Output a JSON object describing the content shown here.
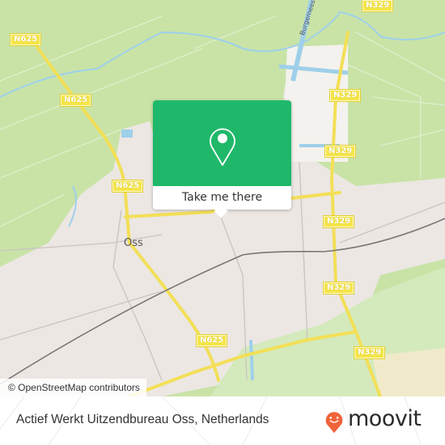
{
  "map": {
    "city_label": "Oss",
    "street_label": "Burgemeest",
    "road_labels": [
      {
        "id": "n625-a",
        "text": "N625"
      },
      {
        "id": "n625-b",
        "text": "N625"
      },
      {
        "id": "n625-c",
        "text": "N625"
      },
      {
        "id": "n625-d",
        "text": "N625"
      },
      {
        "id": "n329-a",
        "text": "N329"
      },
      {
        "id": "n329-b",
        "text": "N329"
      },
      {
        "id": "n329-c",
        "text": "N329"
      },
      {
        "id": "n329-d",
        "text": "N329"
      },
      {
        "id": "n329-e",
        "text": "N329"
      },
      {
        "id": "n329-f",
        "text": "N329"
      }
    ],
    "attribution": "© OpenStreetMap contributors",
    "colors": {
      "countryside": "#c9e3a7",
      "urban": "#ece7e3",
      "water": "#9fd0ea",
      "road": "#f3df57",
      "rail": "#777777"
    }
  },
  "popup": {
    "icon": "map-pin-icon",
    "button_label": "Take me there",
    "accent": "#1fb86a"
  },
  "footer": {
    "place_name": "Actief Werkt Uitzendbureau Oss, Netherlands",
    "brand": "moovit",
    "brand_color": "#f0633a"
  }
}
